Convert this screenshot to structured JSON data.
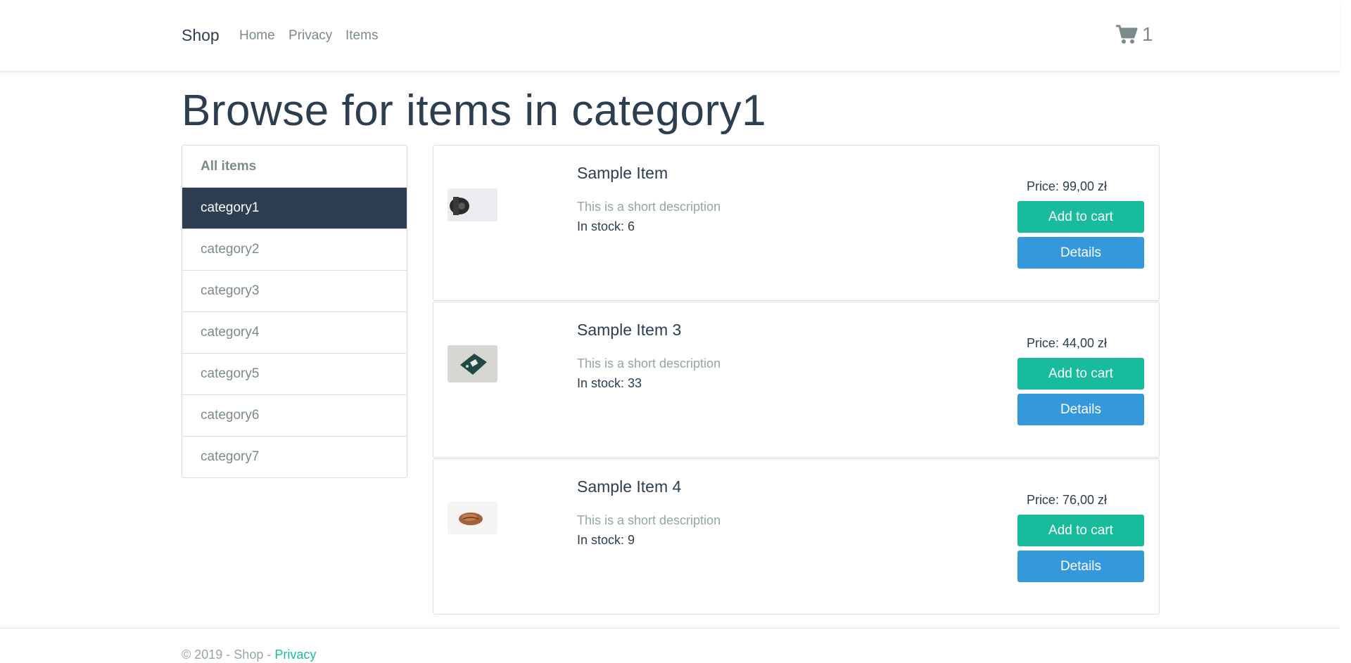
{
  "nav": {
    "brand": "Shop",
    "links": [
      "Home",
      "Privacy",
      "Items"
    ],
    "cart_icon": "shopping-cart-icon",
    "cart_count": "1"
  },
  "page": {
    "title": "Browse for items in category1"
  },
  "sidebar": {
    "items": [
      {
        "label": "All items"
      },
      {
        "label": "category1"
      },
      {
        "label": "category2"
      },
      {
        "label": "category3"
      },
      {
        "label": "category4"
      },
      {
        "label": "category5"
      },
      {
        "label": "category6"
      },
      {
        "label": "category7"
      }
    ],
    "active_color": "#2c3e50"
  },
  "items": [
    {
      "name": "Sample Item",
      "description": "This is a short description",
      "stock_label": "In stock: 6",
      "price": "Price: 99,00 zł",
      "add_label": "Add to cart",
      "details_label": "Details"
    },
    {
      "name": "Sample Item 3",
      "description": "This is a short description",
      "stock_label": "In stock: 33",
      "price": "Price: 44,00 zł",
      "add_label": "Add to cart",
      "details_label": "Details"
    },
    {
      "name": "Sample Item 4",
      "description": "This is a short description",
      "stock_label": "In stock: 9",
      "price": "Price: 76,00 zł",
      "add_label": "Add to cart",
      "details_label": "Details"
    }
  ],
  "footer": {
    "text": "© 2019 - Shop - ",
    "link": "Privacy"
  },
  "colors": {
    "primary": "#2c3e50",
    "success": "#18bc9c",
    "info": "#3498db",
    "muted": "#95a5a6"
  }
}
